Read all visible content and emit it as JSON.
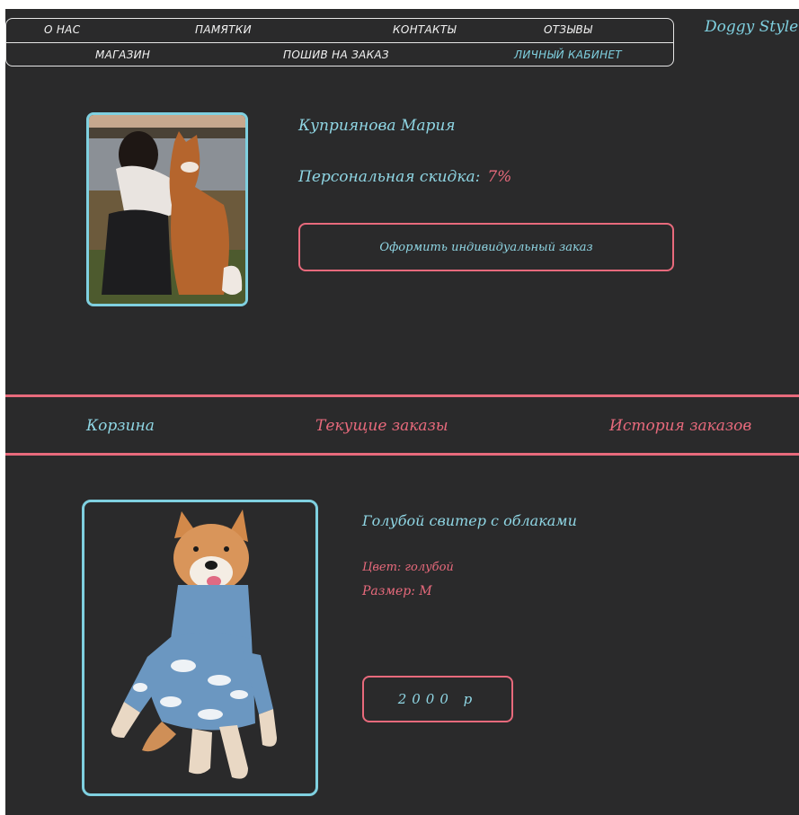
{
  "nav": {
    "row1": [
      "О НАС",
      "ПАМЯТКИ",
      "КОНТАКТЫ",
      "ОТЗЫВЫ"
    ],
    "row2": [
      "МАГАЗИН",
      "ПОШИВ НА ЗАКАЗ",
      "ЛИЧНЫЙ КАБИНЕТ"
    ]
  },
  "brand": "Doggy Style",
  "profile": {
    "name": "Куприянова Мария",
    "discount_label": "Персональная скидка:",
    "discount_value": "7%",
    "order_button": "Оформить индивидуальный заказ"
  },
  "tabs": [
    "Корзина",
    "Текущие заказы",
    "История заказов"
  ],
  "product": {
    "title": "Голубой свитер с облаками",
    "color_line": "Цвет: голубой",
    "size_line": "Размер: М",
    "price": "2000 р"
  },
  "colors": {
    "accent_cyan": "#7fd0e0",
    "accent_pink": "#e86a7c",
    "background": "#2a2a2b"
  }
}
